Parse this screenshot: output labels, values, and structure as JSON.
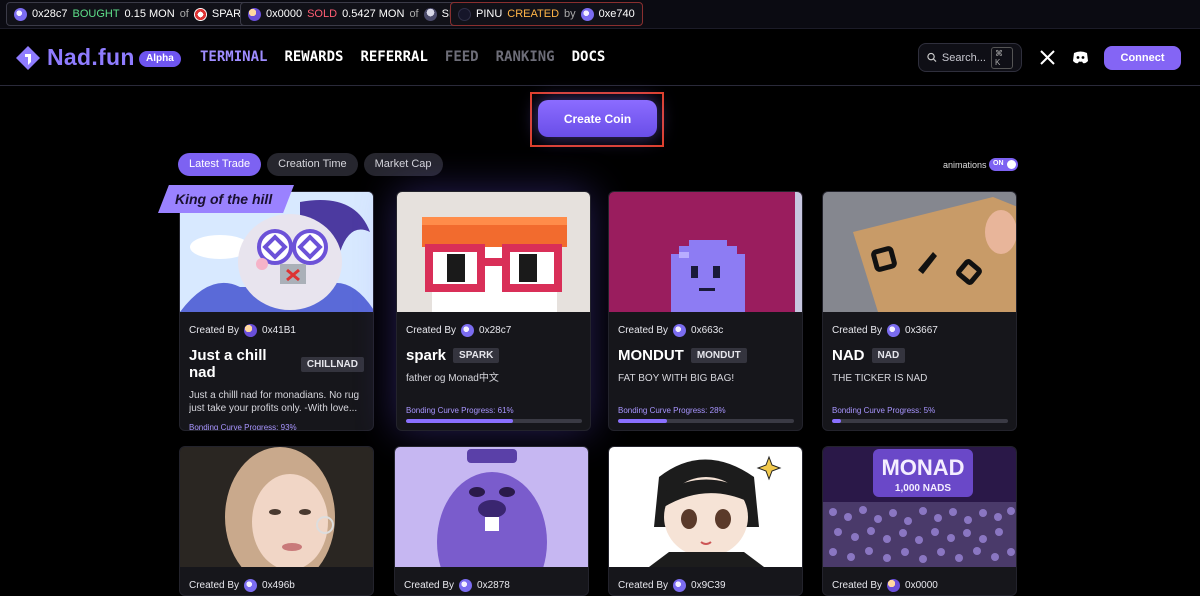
{
  "ticker": [
    {
      "address": "0x28c7",
      "action": "BOUGHT",
      "amount": "0.15 MON",
      "of": "of",
      "token": "SPARK"
    },
    {
      "address": "0x0000",
      "action": "SOLD",
      "amount": "0.5427 MON",
      "of": "of",
      "token": "SL"
    },
    {
      "token": "PINU",
      "action": "CREATED",
      "by": "by",
      "address": "0xe740"
    }
  ],
  "header": {
    "logo": "Nad.fun",
    "alpha": "Alpha",
    "nav": [
      "TERMINAL",
      "REWARDS",
      "REFERRAL",
      "FEED",
      "RANKING",
      "DOCS"
    ],
    "search_placeholder": "Search...",
    "search_kbd": "⌘ K",
    "connect": "Connect"
  },
  "create_coin": "Create Coin",
  "filters": [
    "Latest Trade",
    "Creation Time",
    "Market Cap"
  ],
  "animations": {
    "label": "animations",
    "state": "ON"
  },
  "king_label": "King of the hill",
  "created_by_label": "Created By",
  "progress_label": "Bonding Curve Progress:",
  "cards": [
    {
      "creator": "0x41B1",
      "name": "Just a chill nad",
      "ticker": "CHILLNAD",
      "desc": "Just a chilll nad for monadians. No rug just take your profits only. -With love...",
      "progress": "93%",
      "progress_value": 93
    },
    {
      "creator": "0x28c7",
      "name": "spark",
      "ticker": "SPARK",
      "desc": "father og Monad中文",
      "progress": "61%",
      "progress_value": 61
    },
    {
      "creator": "0x663c",
      "name": "MONDUT",
      "ticker": "MONDUT",
      "desc": "FAT BOY WITH BIG BAG!",
      "progress": "28%",
      "progress_value": 28
    },
    {
      "creator": "0x3667",
      "name": "NAD",
      "ticker": "NAD",
      "desc": "THE TICKER IS NAD",
      "progress": "5%",
      "progress_value": 5
    },
    {
      "creator": "0x496b"
    },
    {
      "creator": "0x2878"
    },
    {
      "creator": "0x9C39"
    },
    {
      "creator": "0x0000",
      "image_text": "MONAD",
      "image_subtext": "1,000 NADS"
    }
  ]
}
